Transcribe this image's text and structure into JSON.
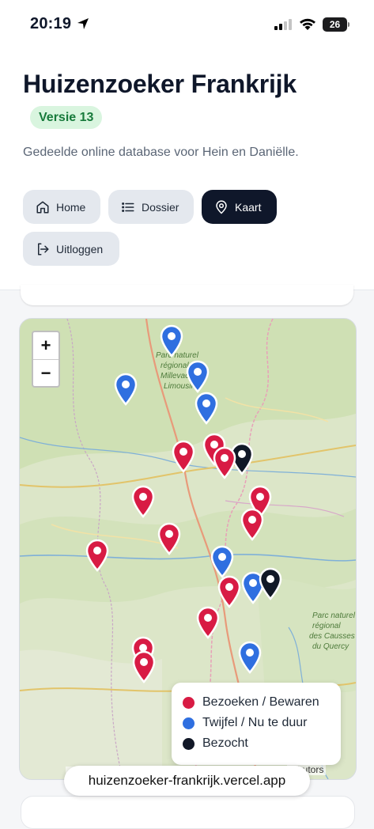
{
  "status_bar": {
    "time": "20:19",
    "battery_level": "26",
    "icons": [
      "location-arrow-icon",
      "signal-icon",
      "wifi-icon",
      "battery-icon"
    ]
  },
  "header": {
    "title": "Huizenzoeker Frankrijk",
    "version_badge": "Versie 13",
    "subtitle": "Gedeelde online database voor Hein en Daniëlle."
  },
  "nav": {
    "home": "Home",
    "dossier": "Dossier",
    "kaart": "Kaart",
    "logout": "Uitloggen",
    "active": "Kaart"
  },
  "map": {
    "zoom_in": "+",
    "zoom_out": "−",
    "place_labels": [
      "Parc naturel régional de Millevaches en Limousin",
      "Parc naturel régional des Causses du Quercy"
    ],
    "legend": [
      {
        "label": "Bezoeken / Bewaren",
        "color": "#d81b44"
      },
      {
        "label": "Twijfel / Nu te duur",
        "color": "#2f6fe0"
      },
      {
        "label": "Bezocht",
        "color": "#111827"
      }
    ],
    "attribution": "tributors"
  },
  "browser": {
    "url": "huizenzoeker-frankrijk.vercel.app"
  }
}
